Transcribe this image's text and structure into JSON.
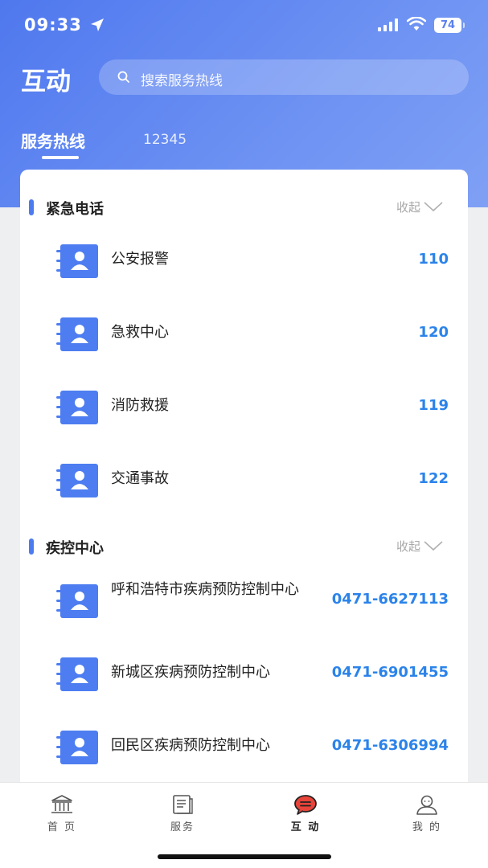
{
  "status_bar": {
    "time": "09:33",
    "battery": "74"
  },
  "header": {
    "title": "互动",
    "search_placeholder": "搜索服务热线"
  },
  "tabs": [
    {
      "label": "服务热线",
      "active": true
    },
    {
      "label": "12345",
      "active": false
    }
  ],
  "sections": [
    {
      "title": "紧急电话",
      "collapse_label": "收起",
      "items": [
        {
          "name": "公安报警",
          "phone": "110"
        },
        {
          "name": "急救中心",
          "phone": "120"
        },
        {
          "name": "消防救援",
          "phone": "119"
        },
        {
          "name": "交通事故",
          "phone": "122"
        }
      ]
    },
    {
      "title": "疾控中心",
      "collapse_label": "收起",
      "items": [
        {
          "name": "呼和浩特市疾病预防控制中心",
          "phone": "0471-6627113"
        },
        {
          "name": "新城区疾病预防控制中心",
          "phone": "0471-6901455"
        },
        {
          "name": "回民区疾病预防控制中心",
          "phone": "0471-6306994"
        }
      ]
    }
  ],
  "tabbar": [
    {
      "label": "首 页",
      "icon": "bank-icon"
    },
    {
      "label": "服务",
      "icon": "document-icon"
    },
    {
      "label": "互 动",
      "icon": "chat-icon",
      "active": true
    },
    {
      "label": "我 的",
      "icon": "user-icon"
    }
  ],
  "colors": {
    "brand": "#4f78ee",
    "phone": "#2b83ea",
    "chat_active": "#e8443a"
  }
}
